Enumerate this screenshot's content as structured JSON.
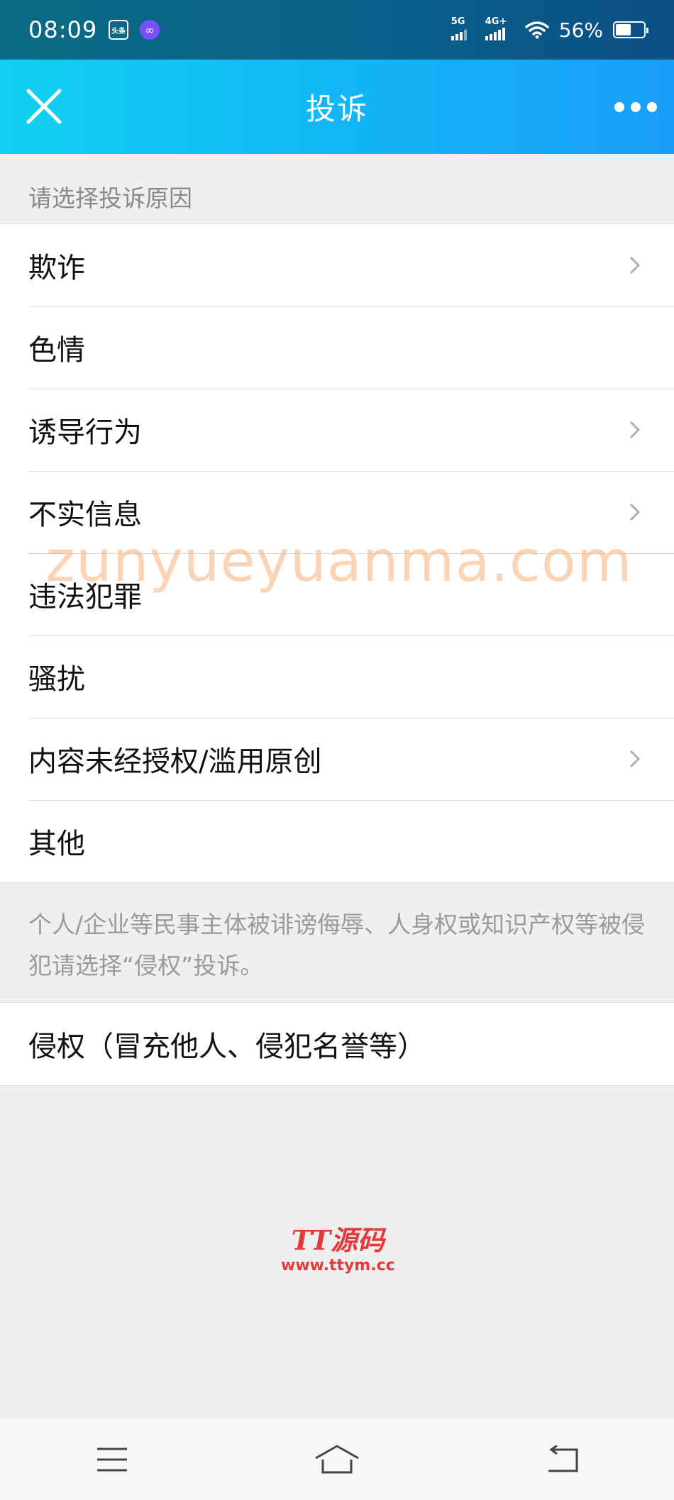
{
  "status_bar": {
    "time": "08:09",
    "app_icon_1_label": "头条",
    "app_icon_2": "loop-icon",
    "net1_label": "5G",
    "net2_label": "4G+",
    "battery_text": "56%",
    "battery_level": 0.56
  },
  "nav": {
    "title": "投诉"
  },
  "section": {
    "header": "请选择投诉原因"
  },
  "reasons": [
    {
      "label": "欺诈",
      "has_arrow": true
    },
    {
      "label": "色情",
      "has_arrow": false
    },
    {
      "label": "诱导行为",
      "has_arrow": true
    },
    {
      "label": "不实信息",
      "has_arrow": true
    },
    {
      "label": "违法犯罪",
      "has_arrow": false
    },
    {
      "label": "骚扰",
      "has_arrow": false
    },
    {
      "label": "内容未经授权/滥用原创",
      "has_arrow": true
    },
    {
      "label": "其他",
      "has_arrow": false
    }
  ],
  "notice": {
    "text": "个人/企业等民事主体被诽谤侮辱、人身权或知识产权等被侵犯请选择“侵权”投诉。"
  },
  "infringement": {
    "label": "侵权（冒充他人、侵犯名誉等）"
  },
  "watermark": {
    "text": "zunyueyuanma.com"
  },
  "logo": {
    "line1": "TT源码",
    "line2": "www.ttym.cc"
  },
  "colors": {
    "nav_gradient_start": "#12d0f2",
    "nav_gradient_end": "#1a9ef8",
    "status_bar": "#0a5f8a",
    "watermark": "#f7a05a",
    "logo": "#e23b3b"
  }
}
